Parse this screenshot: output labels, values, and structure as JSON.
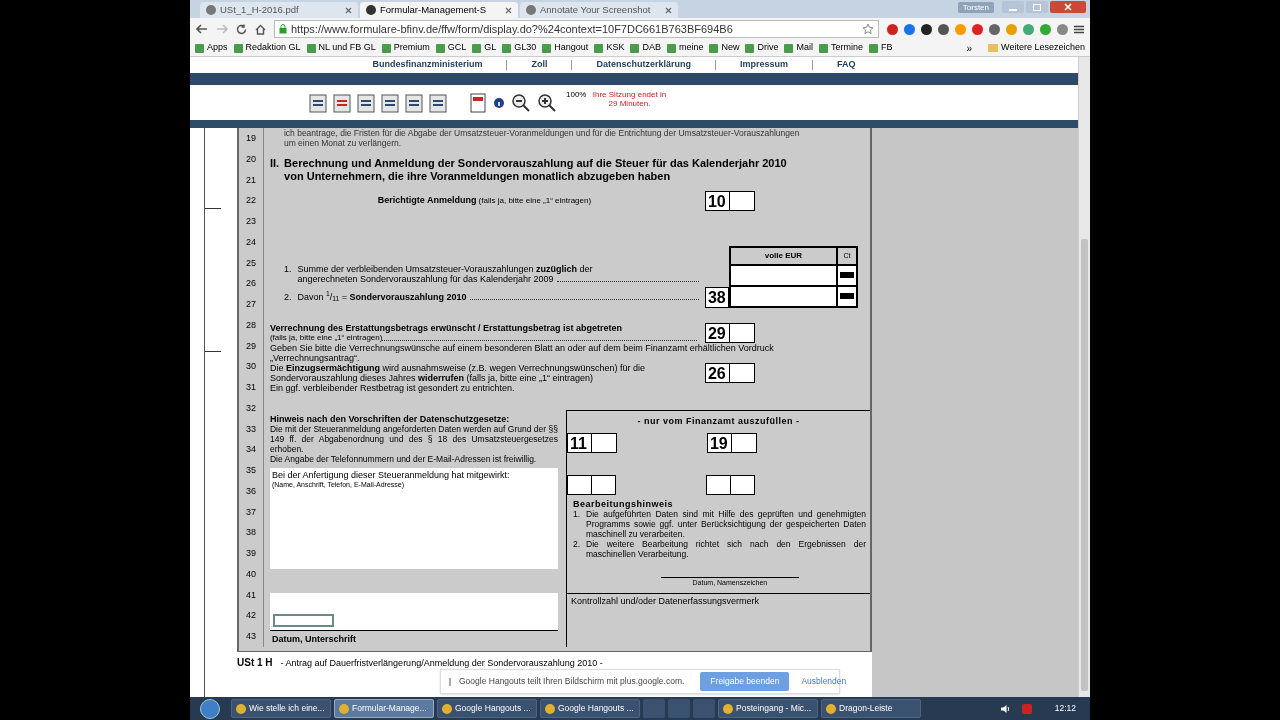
{
  "browser": {
    "tabs": [
      {
        "label": "USt_1_H-2016.pdf",
        "selected": false
      },
      {
        "label": "Formular-Management-S",
        "selected": true
      },
      {
        "label": "Annotate Your Screenshot",
        "selected": false
      }
    ],
    "profile": "Torsten",
    "url": "https://www.formulare-bfinv.de/ffw/form/display.do?%24context=10F7DC661B763BF694B6",
    "bookmarks": [
      "Apps",
      "Redaktion GL",
      "NL und FB GL",
      "Premium",
      "GCL",
      "GL",
      "GL30",
      "Hangout",
      "KSK",
      "DAB",
      "meine",
      "New",
      "Drive",
      "Mail",
      "Termine",
      "FB"
    ],
    "overflow": "»",
    "other_bookmarks": "Weitere Lesezeichen"
  },
  "site_nav": [
    "Bundesfinanzministerium",
    "Zoll",
    "Datenschutzerklärung",
    "Impressum",
    "FAQ"
  ],
  "toolbar": {
    "zoom": "100%",
    "session": "Ihre Sitzung endet in 29 Minuten."
  },
  "form": {
    "line_numbers": [
      "19",
      "20",
      "21",
      "22",
      "23",
      "24",
      "25",
      "26",
      "27",
      "28",
      "29",
      "30",
      "31",
      "32",
      "33",
      "34",
      "35",
      "36",
      "37",
      "38",
      "39",
      "40",
      "41",
      "42",
      "43"
    ],
    "intro": [
      "ich beantrage, die Fristen für die Abgabe der Umsatzsteuer-Voranmeldungen und für die Entrichtung der Umsatzsteuer-Vorauszahlungen",
      "um einen Monat zu verlängern."
    ],
    "section": {
      "number": "II.",
      "title": [
        "Berechnung und Anmeldung der Sondervorauszahlung auf die Steuer für das Kalenderjahr 2010",
        "von Unternehmern, die ihre Voranmeldungen monatlich abzugeben haben"
      ]
    },
    "corrected": {
      "label": "Berichtigte Anmeldung",
      "hint": "(falls ja, bitte eine „1“ eintragen)",
      "code": "10"
    },
    "amount_table": {
      "columns": [
        "volle EUR",
        "Ct"
      ],
      "rows": [
        {
          "number": "1.",
          "text": [
            "Summe der verbleibenden Umsatzsteuer-Vorauszahlungen  **zuzüglich** der",
            "angerechneten Sondervorauszahlung für das Kalenderjahr 2009"
          ]
        },
        {
          "number": "2.",
          "text": [
            "Davon $^{1}$/$_{11}$ = **Sondervorauszahlung 2010**"
          ],
          "code": "38"
        }
      ]
    },
    "offset": {
      "title": "Verrechnung des Erstattungsbetrags erwünscht / Erstattungsbetrag ist abgetreten",
      "hint": "(falls ja, bitte eine „1“ eintragen)",
      "code": "29",
      "note": "Geben Sie bitte die Verrechnungswünsche auf einem besonderen Blatt an oder auf dem beim Finanzamt erhältlichen Vordruck „Verrechnungsantrag“."
    },
    "revocation": {
      "text": "Die **Einzugsermächtigung** wird ausnahmsweise (z.B. wegen Verrechnungswünschen) für die Sondervorauszahlung dieses Jahres **widerrufen** (falls ja, bitte eine „1“ eintragen)",
      "code": "26",
      "note": "Ein ggf. verbleibender Restbetrag ist gesondert zu entrichten."
    },
    "privacy": {
      "title": "Hinweis nach den Vorschriften der Datenschutzgesetze:",
      "text": "Die mit der Steueranmeldung angeforderten Daten werden auf Grund der §§ 149 ff. der Abgabenordnung und des § 18 des Umsatzsteuergesetzes erhoben.",
      "note": "Die Angabe der Telefonnummern und der E-Mail-Adressen ist freiwillig."
    },
    "preparer_box": {
      "label": "Bei der Anfertigung dieser Steueranmeldung hat mitgewirkt:",
      "hint": "(Name, Anschrift, Telefon, E-Mail-Adresse)"
    },
    "signature": {
      "label": "Datum,  Unterschrift"
    },
    "office_panel": {
      "title": "- nur vom Finanzamt auszufüllen -",
      "codes": [
        "11",
        "19"
      ],
      "note_title": "Bearbeitungshinweis",
      "notes": [
        {
          "number": "1.",
          "text": "Die aufgeführten Daten sind mit Hilfe des geprüften und genehmigten Programms sowie ggf. unter Berücksichtigung der gespeicherten Daten maschinell zu verarbeiten."
        },
        {
          "number": "2.",
          "text": "Die weitere Bearbeitung richtet sich nach den Ergebnissen der maschinellen Verarbeitung."
        }
      ],
      "signature_label": "Datum, Namenszeichen",
      "control_label": "Kontrollzahl und/oder Datenerfassungsvermerk"
    }
  },
  "footer": {
    "code": "USt 1 H",
    "title": "- Antrag auf Dauerfristverlängerung/Anmeldung der Sondervorauszahlung 2010 -"
  },
  "notification": {
    "text": "Google Hangouts teilt Ihren Bildschirm mit plus.google.com.",
    "primary": "Freigabe beenden",
    "secondary": "Ausblenden"
  },
  "taskbar": {
    "items": [
      {
        "label": "Wie stelle ich eine...",
        "selected": false
      },
      {
        "label": "Formular-Manage...",
        "selected": true
      },
      {
        "label": "Google Hangouts ...",
        "selected": false
      },
      {
        "label": "Google Hangouts ...",
        "selected": false
      },
      {
        "label": "Posteingang - Mic...",
        "selected": false
      },
      {
        "label": "Dragon-Leiste",
        "selected": false
      }
    ],
    "time": "12:12"
  }
}
